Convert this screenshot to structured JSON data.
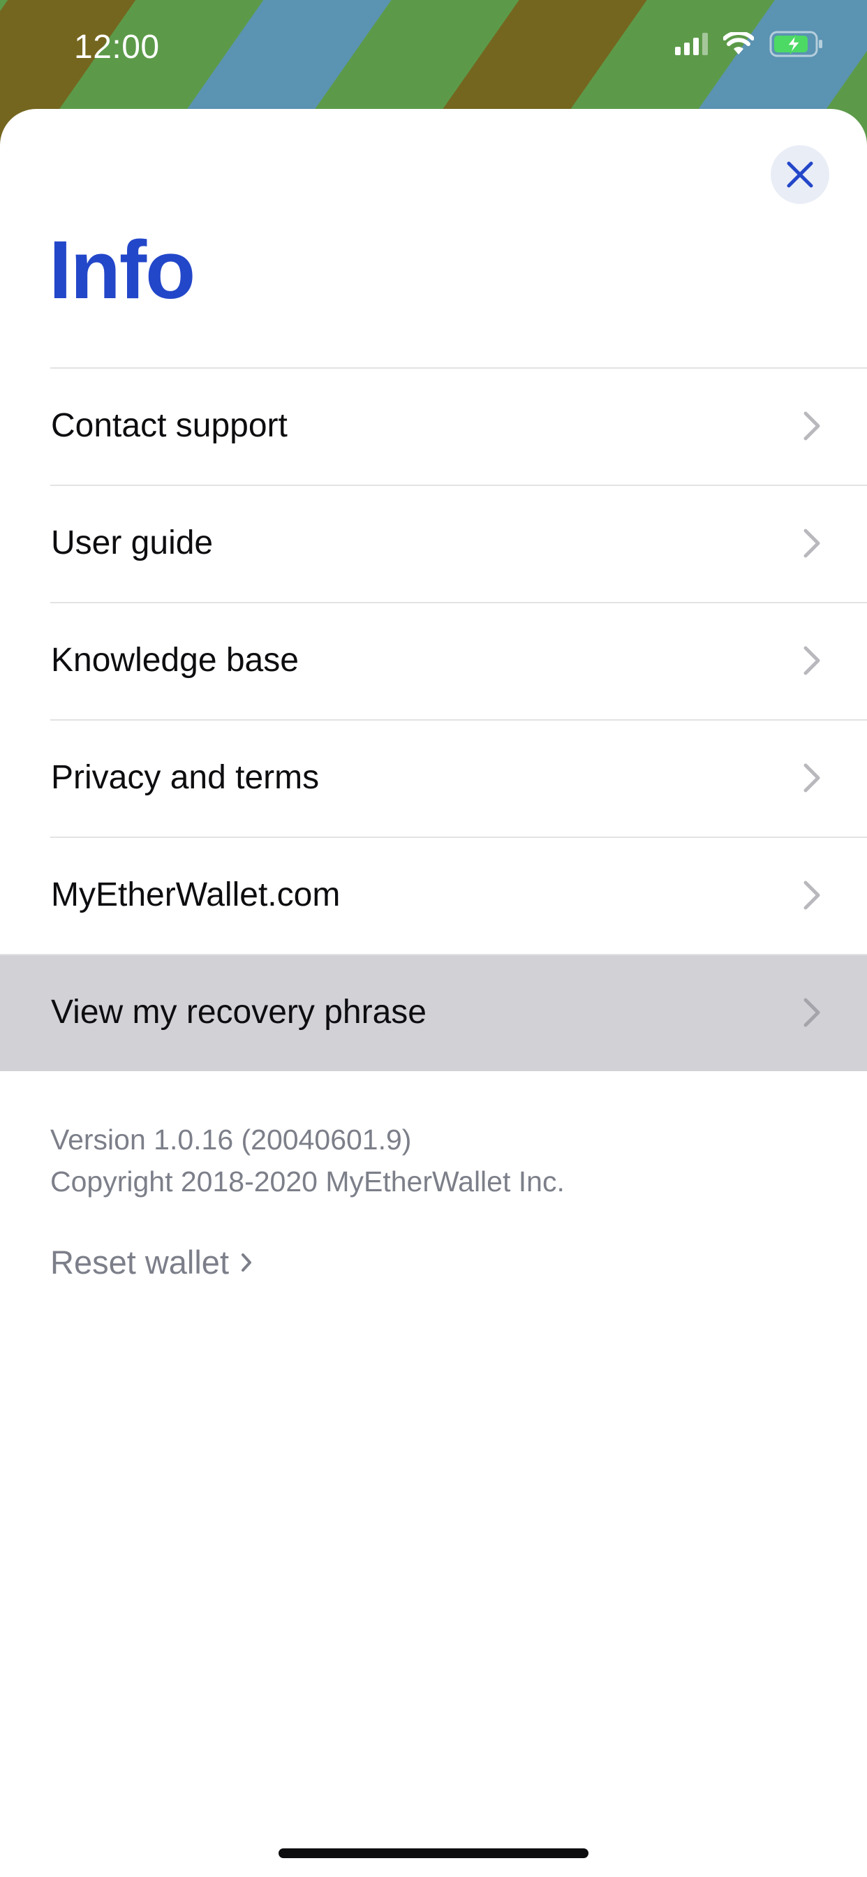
{
  "status_bar": {
    "time": "12:00",
    "icons": [
      "cellular-signal-icon",
      "wifi-icon",
      "battery-charging-icon"
    ]
  },
  "sheet": {
    "title": "Info",
    "close_icon": "close-icon",
    "menu_items": [
      {
        "label": "Contact support",
        "icon": "chevron-right-icon",
        "highlighted": false
      },
      {
        "label": "User guide",
        "icon": "chevron-right-icon",
        "highlighted": false
      },
      {
        "label": "Knowledge base",
        "icon": "chevron-right-icon",
        "highlighted": false
      },
      {
        "label": "Privacy and terms",
        "icon": "chevron-right-icon",
        "highlighted": false
      },
      {
        "label": "MyEtherWallet.com",
        "icon": "chevron-right-icon",
        "highlighted": false
      },
      {
        "label": "View my recovery phrase",
        "icon": "chevron-right-icon",
        "highlighted": true
      }
    ],
    "version": "Version 1.0.16 (20040601.9)",
    "copyright": "Copyright 2018-2020 MyEtherWallet Inc.",
    "reset_wallet": "Reset wallet"
  },
  "colors": {
    "accent": "#2347c9",
    "highlight_row": "#d1d1d6",
    "secondary_text": "#7c7f89",
    "battery": "#4cd964"
  }
}
